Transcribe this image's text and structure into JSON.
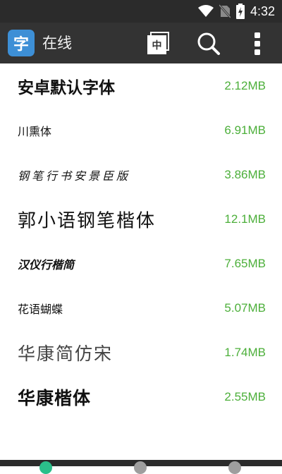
{
  "status_bar": {
    "time": "4:32",
    "icons": [
      "wifi-icon",
      "no-sim-icon",
      "battery-charging-icon"
    ]
  },
  "app_bar": {
    "logo_char": "字",
    "title": "在线",
    "lang_toggle_label": "中",
    "actions": [
      "language-toggle-icon",
      "search-icon",
      "more-vert-icon"
    ]
  },
  "fonts": [
    {
      "name": "安卓默认字体",
      "size": "2.12MB"
    },
    {
      "name": "川熏体",
      "size": "6.91MB"
    },
    {
      "name": "钢笔行书安景臣版",
      "size": "3.86MB"
    },
    {
      "name": "郭小语钢笔楷体",
      "size": "12.1MB"
    },
    {
      "name": "汉仪行楷简",
      "size": "7.65MB"
    },
    {
      "name": "花语蝴蝶",
      "size": "5.07MB"
    },
    {
      "name": "华康简仿宋",
      "size": "1.74MB"
    },
    {
      "name": "华康楷体",
      "size": "2.55MB"
    }
  ],
  "colors": {
    "app_bar": "#333333",
    "status_bar": "#2b2b2b",
    "size_text": "#4caf3a",
    "logo_bg": "#3d8fd6",
    "nav_dot_active": "#2bbf8a",
    "nav_dot_inactive": "#9e9e9e"
  }
}
